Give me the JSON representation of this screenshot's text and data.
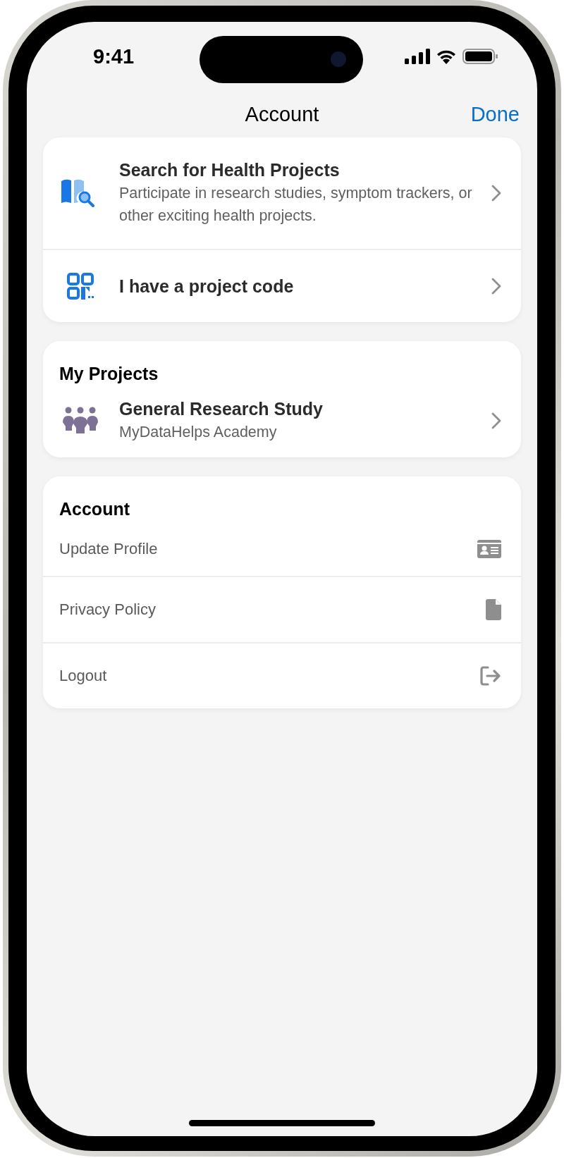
{
  "status_bar": {
    "time": "9:41"
  },
  "nav": {
    "title": "Account",
    "done": "Done"
  },
  "discover": [
    {
      "kind": "search",
      "title": "Search for Health Projects",
      "subtitle": "Participate in research studies, symptom trackers, or other exciting health projects."
    },
    {
      "kind": "code",
      "title": "I have a project code"
    }
  ],
  "my_projects": {
    "heading": "My Projects",
    "items": [
      {
        "title": "General Research Study",
        "subtitle": "MyDataHelps Academy"
      }
    ]
  },
  "account": {
    "heading": "Account",
    "items": [
      {
        "kind": "profile",
        "label": "Update Profile"
      },
      {
        "kind": "privacy",
        "label": "Privacy Policy"
      },
      {
        "kind": "logout",
        "label": "Logout"
      }
    ]
  }
}
